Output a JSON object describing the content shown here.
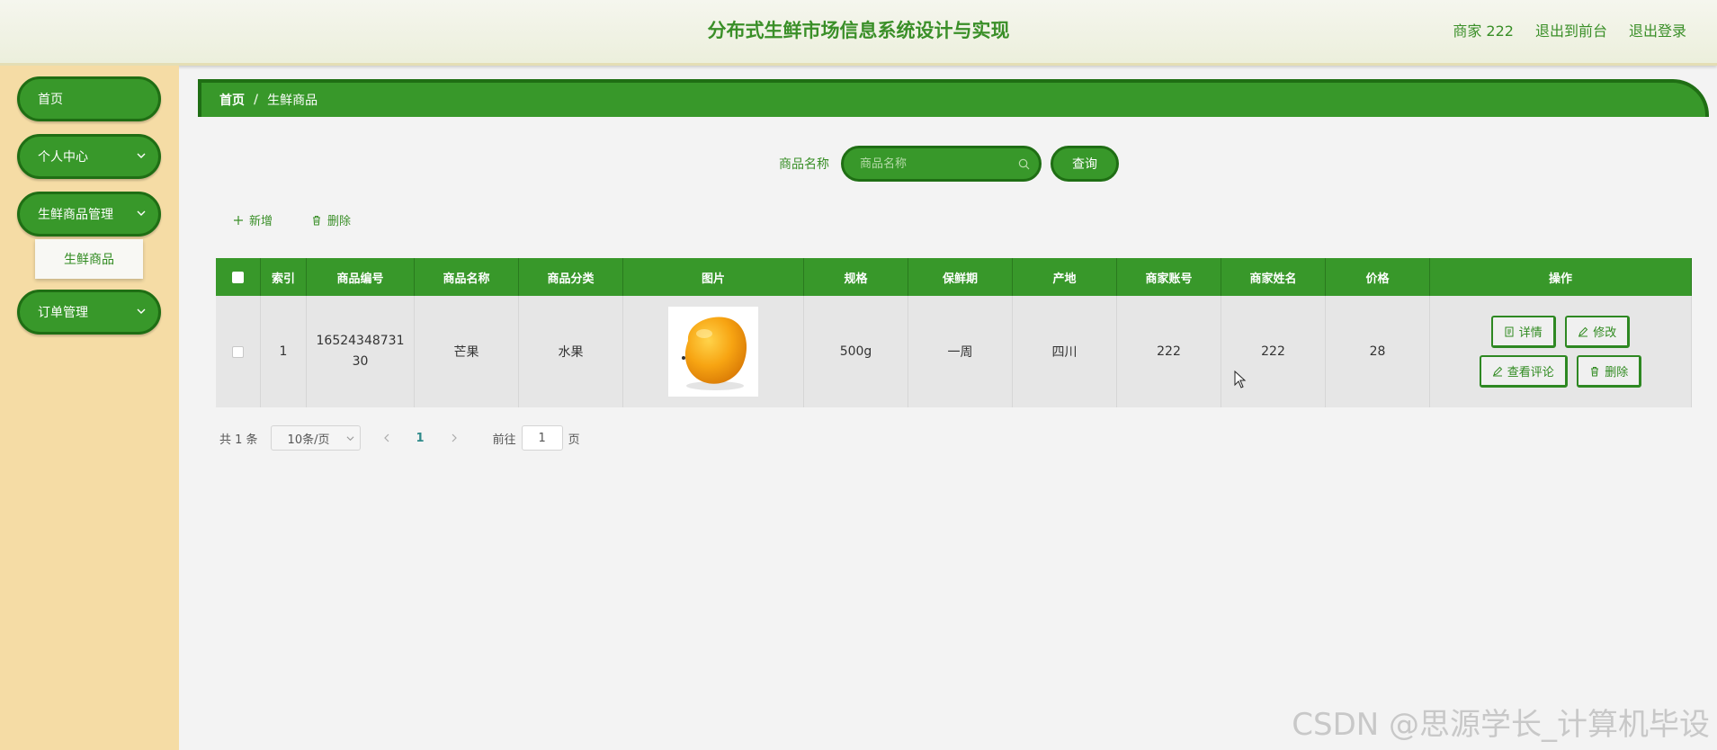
{
  "header": {
    "title": "分布式生鲜市场信息系统设计与实现",
    "user": "商家 222",
    "exit_front": "退出到前台",
    "logout": "退出登录"
  },
  "sidebar": {
    "items": [
      {
        "label": "首页"
      },
      {
        "label": "个人中心"
      },
      {
        "label": "生鲜商品管理"
      },
      {
        "label": "订单管理"
      }
    ],
    "sub_item": "生鲜商品"
  },
  "breadcrumb": {
    "home": "首页",
    "sep": "/",
    "current": "生鲜商品"
  },
  "search": {
    "label": "商品名称",
    "placeholder": "商品名称",
    "button": "查询"
  },
  "actions": {
    "add": "新增",
    "delete": "删除"
  },
  "table": {
    "headers": [
      "索引",
      "商品编号",
      "商品名称",
      "商品分类",
      "图片",
      "规格",
      "保鲜期",
      "产地",
      "商家账号",
      "商家姓名",
      "价格",
      "操作"
    ],
    "rows": [
      {
        "index": "1",
        "code_line1": "16524348731",
        "code_line2": "30",
        "name": "芒果",
        "category": "水果",
        "spec": "500g",
        "shelf_life": "一周",
        "origin": "四川",
        "account": "222",
        "merchant_name": "222",
        "price": "28"
      }
    ],
    "ops": {
      "detail": "详情",
      "edit": "修改",
      "comments": "查看评论",
      "delete": "删除"
    }
  },
  "pagination": {
    "total": "共 1 条",
    "page_size": "10条/页",
    "current_page": "1",
    "goto_label": "前往",
    "goto_value": "1",
    "goto_unit": "页"
  },
  "watermark": "CSDN @思源学长_计算机毕设",
  "colors": {
    "primary": "#38982a",
    "primary_dark": "#1f6e14",
    "sidebar_bg": "#f5dca5",
    "page_bg": "#f3f3f3"
  }
}
